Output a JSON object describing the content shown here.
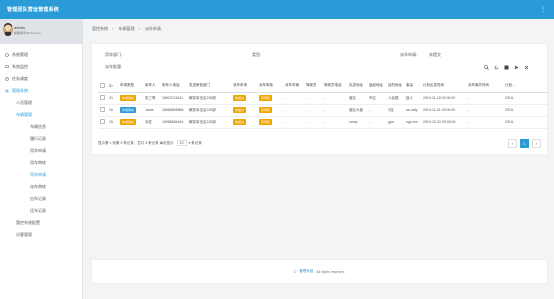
{
  "app": {
    "title": "管理团队营运管理系统",
    "accent": "#2b9bd8"
  },
  "user": {
    "name": "admin",
    "email": "邮箱账号@163.com"
  },
  "sidebar": {
    "items": [
      {
        "label": "系统管理",
        "icon": "gear-icon"
      },
      {
        "label": "系统监控",
        "icon": "monitor-icon"
      },
      {
        "label": "任务调度",
        "icon": "clock-icon"
      },
      {
        "label": "管理系统",
        "icon": "list-icon"
      }
    ],
    "sub": [
      {
        "label": "人员管理"
      },
      {
        "label": "车辆管理"
      }
    ],
    "leaves": [
      {
        "label": "车辆信息"
      },
      {
        "label": "履行记录"
      },
      {
        "label": "用车申请"
      },
      {
        "label": "用车审核"
      },
      {
        "label": "用车申请"
      },
      {
        "label": "派车审核"
      },
      {
        "label": "出车记录"
      },
      {
        "label": "还车记录"
      }
    ],
    "tail": [
      {
        "label": "管控系统配置"
      },
      {
        "label": "访客管理"
      }
    ]
  },
  "breadcrumb": [
    "管控系统",
    "车辆管理",
    "派车申请"
  ],
  "filters": {
    "applicant_label": "用车部门:",
    "type_label": "类型:",
    "status_label": "派车申请:",
    "status_value": "未提交",
    "batch_label": "派车批量:"
  },
  "table": {
    "headers": [
      "",
      "ID",
      "申请类型",
      "用车人",
      "用车人电话",
      "发送审批部门",
      "派车申请",
      "派车审批",
      "派车车辆",
      "驾驶员",
      "驾驶员电话",
      "出发地址",
      "途经地址",
      "目的地址",
      "事由",
      "计划出发时间",
      "派车离开时间",
      "计划..."
    ],
    "rows": [
      {
        "id": "21",
        "type": "本地用车",
        "type_color": "#f0a500",
        "user": "张三哥",
        "phone": "18623716411",
        "dept": "解放军全区235部",
        "apply": "未提交",
        "review": "待审核",
        "car": "-",
        "driver": "-",
        "dphone": "-",
        "from": "营区",
        "via": "市区",
        "to": "人民路",
        "reason": "接人",
        "plan": "2019-11-18 00:00:00",
        "leave": "-",
        "more": "2019-"
      },
      {
        "id": "16",
        "type": "外地用车",
        "type_color": "#2b9bd8",
        "user": "Jame",
        "phone": "18668808868",
        "dept": "解放军全区225部",
        "apply": "未提交",
        "review": "待审核",
        "car": "-",
        "driver": "-",
        "dphone": "-",
        "from": "营区大营",
        "via": "-",
        "to": "3连",
        "reason": "ss-rady",
        "plan": "2019-11-01 00:00:00",
        "leave": "-",
        "more": "2019-"
      },
      {
        "id": "15",
        "type": "本地用车",
        "type_color": "#f0a500",
        "user": "韦狂",
        "phone": "18988684444",
        "dept": "解放军全区225部",
        "apply": "未提交",
        "review": "待审核",
        "car": "-",
        "driver": "-",
        "dphone": "-",
        "from": "camp",
        "via": "-",
        "to": "gps",
        "reason": "cgs-ren",
        "plan": "2019-10-31 00:00:00",
        "leave": "-",
        "more": "2019-"
      }
    ],
    "badge_orange": "#f0a500"
  },
  "pager": {
    "summary": "显示第 1 到第 3 条记录，总共 3 条记录 每页显示",
    "page_size": "10",
    "suffix": "条记录",
    "prev": "‹",
    "current": "1",
    "next": "›"
  },
  "footer": {
    "copyright": "©",
    "link": "管理系统",
    "rights": "All rights reserved."
  }
}
